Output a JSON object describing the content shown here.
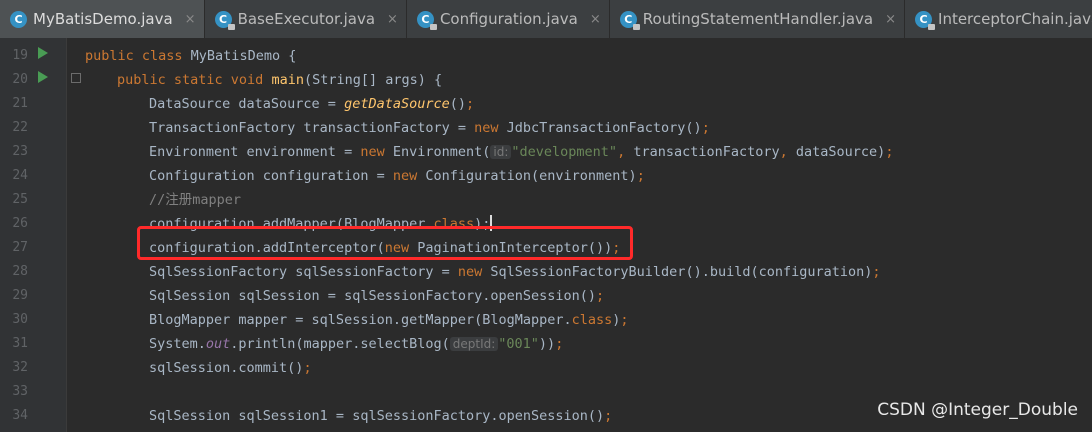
{
  "tabs": [
    {
      "label": "MyBatisDemo.java",
      "icon": "class-icon",
      "active": true
    },
    {
      "label": "BaseExecutor.java",
      "icon": "class-locked-icon",
      "active": false
    },
    {
      "label": "Configuration.java",
      "icon": "class-locked-icon",
      "active": false
    },
    {
      "label": "RoutingStatementHandler.java",
      "icon": "class-locked-icon",
      "active": false
    },
    {
      "label": "InterceptorChain.java",
      "icon": "class-locked-icon",
      "active": false
    }
  ],
  "tab_close_glyph": "×",
  "file_icon_letter": "C",
  "line_numbers": [
    "19",
    "20",
    "21",
    "22",
    "23",
    "24",
    "25",
    "26",
    "27",
    "28",
    "29",
    "30",
    "31",
    "32",
    "33",
    "34"
  ],
  "code": {
    "l19": {
      "a": "public class ",
      "b": "MyBatisDemo {"
    },
    "l20": {
      "a": "public static void ",
      "b": "main",
      "c": "(String[] args) {"
    },
    "l21": {
      "a": "DataSource dataSource = ",
      "b": "getDataSource",
      "c": "()",
      "d": ";"
    },
    "l22": {
      "a": "TransactionFactory transactionFactory = ",
      "b": "new ",
      "c": "JdbcTransactionFactory()",
      "d": ";"
    },
    "l23": {
      "a": "Environment environment = ",
      "b": "new ",
      "c": "Environment(",
      "hint": "id:",
      "d": "\"development\"",
      "e": ", ",
      "f": "transactionFactory",
      "g": ", ",
      "h": "dataSource)",
      "i": ";"
    },
    "l24": {
      "a": "Configuration configuration = ",
      "b": "new ",
      "c": "Configuration(environment)",
      "d": ";"
    },
    "l25": {
      "a": "//注册mapper"
    },
    "l26": {
      "a": "configuration.addMapper(BlogMapper.",
      "b": "class",
      "c": ");"
    },
    "l27": {
      "a": "configuration.addInterceptor(",
      "b": "new ",
      "c": "PaginationInterceptor())",
      "d": ";"
    },
    "l28": {
      "a": "SqlSessionFactory sqlSessionFactory = ",
      "b": "new ",
      "c": "SqlSessionFactoryBuilder().build(configuration)",
      "d": ";"
    },
    "l29": {
      "a": "SqlSession sqlSession = sqlSessionFactory.openSession()",
      "b": ";"
    },
    "l30": {
      "a": "BlogMapper mapper = sqlSession.getMapper(BlogMapper.",
      "b": "class",
      "c": ")",
      "d": ";"
    },
    "l31": {
      "a": "System.",
      "b": "out",
      "c": ".println(mapper.selectBlog(",
      "hint": "deptId:",
      "d": "\"001\"",
      "e": "))",
      "f": ";"
    },
    "l32": {
      "a": "sqlSession.commit()",
      "b": ";"
    },
    "l33": {},
    "l34": {
      "a": "SqlSession sqlSession1 = sqlSessionFactory.openSession()",
      "b": ";"
    }
  },
  "watermark": "CSDN @Integer_Double",
  "colors": {
    "highlight_box": "#ff2a2a",
    "keyword": "#cc7832",
    "string": "#6a8759"
  }
}
